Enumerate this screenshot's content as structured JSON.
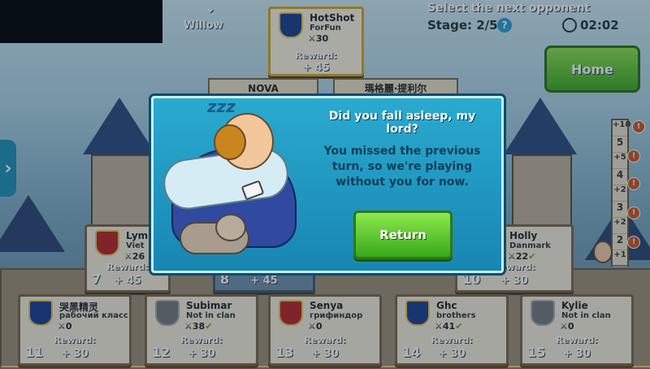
{
  "top": {
    "player_name": "Willow",
    "header": "Select the next opponent",
    "stage": "Stage: 2/5",
    "help": "?",
    "timer": "02:02",
    "home": "Home"
  },
  "boss": {
    "name": "HotShot",
    "clan": "ForFun",
    "swords": "30",
    "reward_label": "Reward:",
    "reward": "+ 45"
  },
  "banners": [
    {
      "text": "NOVA"
    },
    {
      "text": "瑪格麗·提利尔"
    }
  ],
  "middle_row": [
    {
      "name": "Lym",
      "clan": "Viet",
      "swords": "26",
      "num": "7",
      "reward_label": "Reward:",
      "reward": "+ 45"
    },
    {
      "num": "8",
      "reward": "+ 45"
    },
    {
      "name": "Holly",
      "clan": "Danmark",
      "swords": "22",
      "num": "10",
      "reward_label": "Reward:",
      "reward": "+ 30"
    }
  ],
  "bottom_row": [
    {
      "name": "哭黑精灵",
      "clan": "рабочий класс",
      "swords": "0",
      "num": "11",
      "reward_label": "Reward:",
      "reward": "+ 30",
      "shield": "blue"
    },
    {
      "name": "Subimar",
      "clan": "Not in clan",
      "swords": "38",
      "num": "12",
      "reward_label": "Reward:",
      "reward": "+ 30",
      "shield": "gray",
      "check": true
    },
    {
      "name": "Senya",
      "clan": "грифиндор",
      "swords": "0",
      "num": "13",
      "reward_label": "Reward:",
      "reward": "+ 30",
      "shield": "red"
    },
    {
      "name": "Ghc",
      "clan": "brothers",
      "swords": "41",
      "num": "14",
      "reward_label": "Reward:",
      "reward": "+ 30",
      "shield": "blue",
      "check": true
    },
    {
      "name": "Kylie",
      "clan": "Not in clan",
      "swords": "0",
      "num": "15",
      "reward_label": "Reward:",
      "reward": "+ 30",
      "shield": "gray"
    }
  ],
  "ladder": {
    "levels": [
      "+10",
      "5",
      "+5",
      "4",
      "+2",
      "3",
      "+2",
      "2",
      "+1",
      "1"
    ]
  },
  "modal": {
    "title": "Did you fall asleep, my lord?",
    "message": "You missed the previous turn, so we're playing without you for now.",
    "button": "Return",
    "sleep_text": "zzz"
  },
  "colors": {
    "modal_bg": "#1f98c2",
    "button_green": "#4fbf26",
    "message_text": "#0c3e58"
  }
}
